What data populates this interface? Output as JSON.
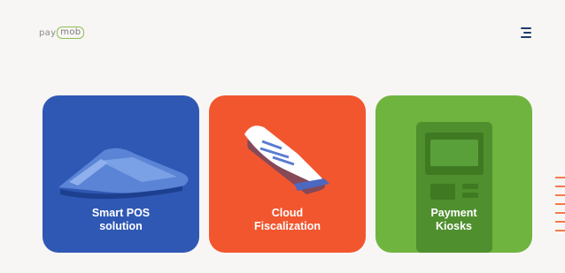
{
  "header": {
    "logo_part1": "pay",
    "logo_part2": "mob",
    "menu_icon": "hamburger-menu-icon"
  },
  "cards": [
    {
      "line1": "Smart POS",
      "line2": "solution",
      "color": "#2f58b4",
      "icon": "pos-terminal-icon"
    },
    {
      "line1": "Cloud",
      "line2": "Fiscalization",
      "color": "#f2562f",
      "icon": "receipt-icon"
    },
    {
      "line1": "Payment",
      "line2": "Kiosks",
      "color": "#6fb43f",
      "icon": "kiosk-icon"
    }
  ],
  "colors": {
    "brand_green": "#8cc152",
    "menu_icon": "#1f3b6b",
    "edge_accent": "#f47a4a",
    "background": "#f8f6f4"
  }
}
